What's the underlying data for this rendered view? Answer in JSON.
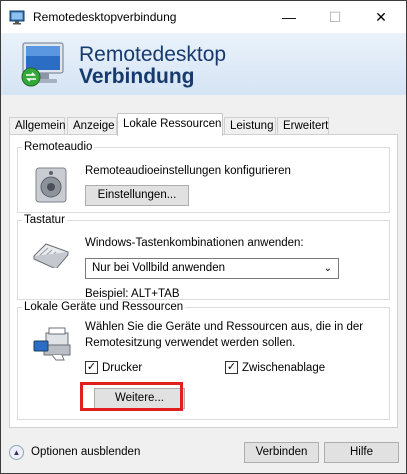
{
  "window": {
    "title": "Remotedesktopverbindung",
    "min_glyph": "—",
    "max_glyph": "☐",
    "close_glyph": "✕"
  },
  "banner": {
    "line1": "Remotedesktop",
    "line2": "Verbindung"
  },
  "tabs": [
    {
      "label": "Allgemein",
      "active": false
    },
    {
      "label": "Anzeige",
      "active": false
    },
    {
      "label": "Lokale Ressourcen",
      "active": true
    },
    {
      "label": "Leistung",
      "active": false
    },
    {
      "label": "Erweitert",
      "active": false
    }
  ],
  "remoteaudio": {
    "legend": "Remoteaudio",
    "description": "Remoteaudioeinstellungen konfigurieren",
    "settings_button": "Einstellungen..."
  },
  "tastatur": {
    "legend": "Tastatur",
    "description": "Windows-Tastenkombinationen anwenden:",
    "selected_option": "Nur bei Vollbild anwenden",
    "example": "Beispiel: ALT+TAB"
  },
  "lokale_geraete": {
    "legend": "Lokale Geräte und Ressourcen",
    "description_line1": "Wählen Sie die Geräte und Ressourcen aus, die in der",
    "description_line2": "Remotesitzung verwendet werden sollen.",
    "drucker_label": "Drucker",
    "drucker_checked": true,
    "zwischenablage_label": "Zwischenablage",
    "zwischenablage_checked": true,
    "more_button": "Weitere..."
  },
  "footer": {
    "options_label": "Optionen ausblenden",
    "connect_button": "Verbinden",
    "help_button": "Hilfe"
  },
  "colors": {
    "banner_text": "#173a6e",
    "highlight": "#e02020"
  }
}
